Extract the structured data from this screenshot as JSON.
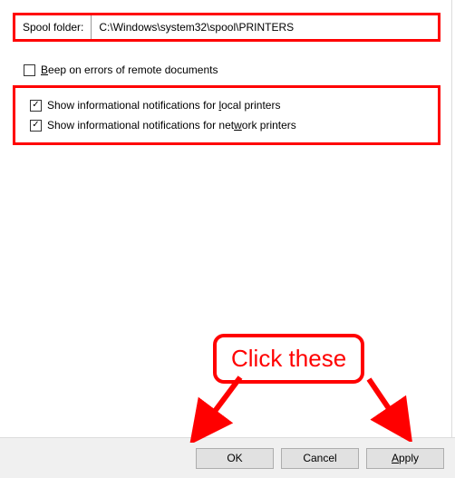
{
  "spool": {
    "label": "Spool folder:",
    "value": "C:\\Windows\\system32\\spool\\PRINTERS"
  },
  "checkboxes": {
    "beep": {
      "label_pre": "",
      "key": "B",
      "label_post": "eep on errors of remote documents",
      "checked": false
    },
    "local": {
      "label_pre": "Show informational notifications for ",
      "key": "l",
      "label_post": "ocal printers",
      "checked": true
    },
    "network": {
      "label_pre": "Show informational notifications for net",
      "key": "w",
      "label_post": "ork printers",
      "checked": true
    }
  },
  "buttons": {
    "ok": "OK",
    "cancel": "Cancel",
    "apply_key": "A",
    "apply_post": "pply"
  },
  "annotation": {
    "callout": "Click these"
  }
}
